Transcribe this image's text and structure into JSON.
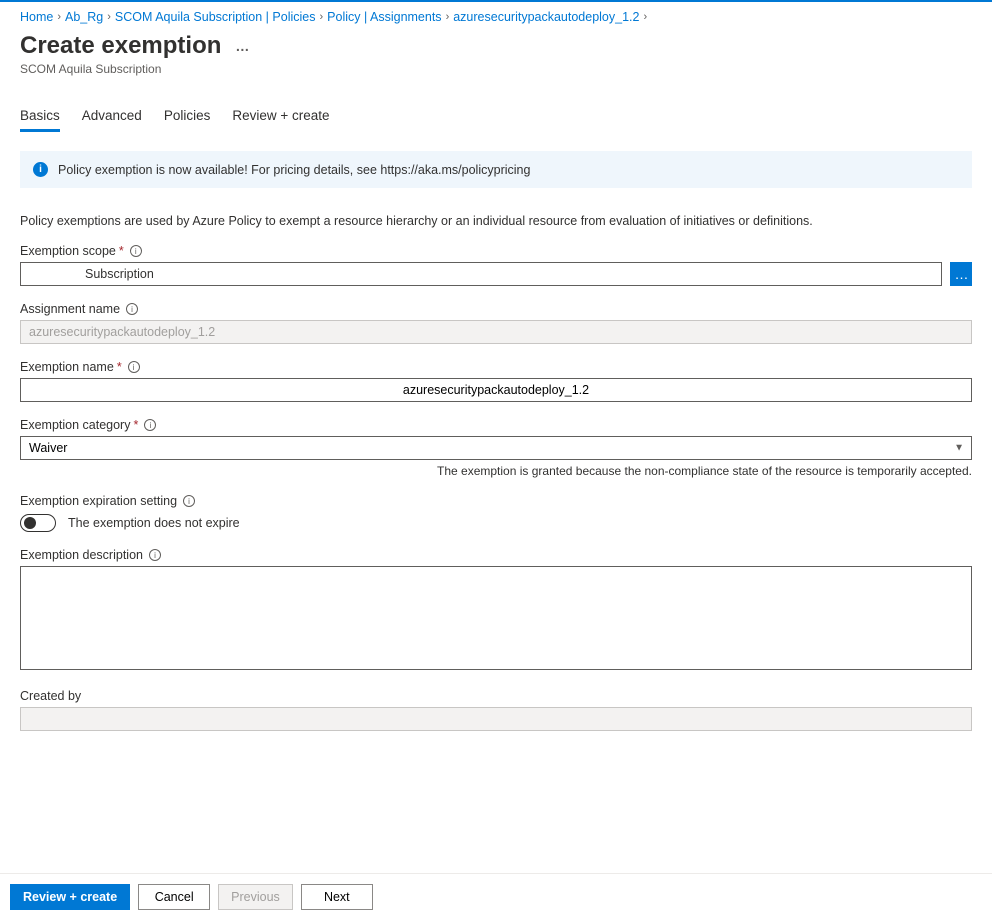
{
  "breadcrumbs": {
    "items": [
      "Home",
      "Ab_Rg",
      "SCOM Aquila Subscription | Policies",
      "Policy | Assignments",
      "azuresecuritypackautodeploy_1.2"
    ]
  },
  "page": {
    "title": "Create exemption",
    "subtitle": "SCOM Aquila Subscription"
  },
  "tabs": {
    "basics": "Basics",
    "advanced": "Advanced",
    "policies": "Policies",
    "review": "Review + create"
  },
  "banner": {
    "text": "Policy exemption is now available! For pricing details, see https://aka.ms/policypricing"
  },
  "description": "Policy exemptions are used by Azure Policy to exempt a resource hierarchy or an individual resource from evaluation of initiatives or definitions.",
  "labels": {
    "scope": "Exemption scope",
    "assignment": "Assignment name",
    "exemption_name": "Exemption name",
    "category": "Exemption category",
    "expiration": "Exemption expiration setting",
    "desc": "Exemption description",
    "created_by": "Created by"
  },
  "values": {
    "scope": "Subscription",
    "assignment": "azuresecuritypackautodeploy_1.2",
    "exemption_name": "azuresecuritypackautodeploy_1.2",
    "category": "Waiver",
    "toggle_label": "The exemption does not expire",
    "desc": "",
    "created_by": ""
  },
  "helper": {
    "category": "The exemption is granted because the non-compliance state of the resource is temporarily accepted."
  },
  "footer": {
    "review": "Review + create",
    "cancel": "Cancel",
    "previous": "Previous",
    "next": "Next"
  }
}
